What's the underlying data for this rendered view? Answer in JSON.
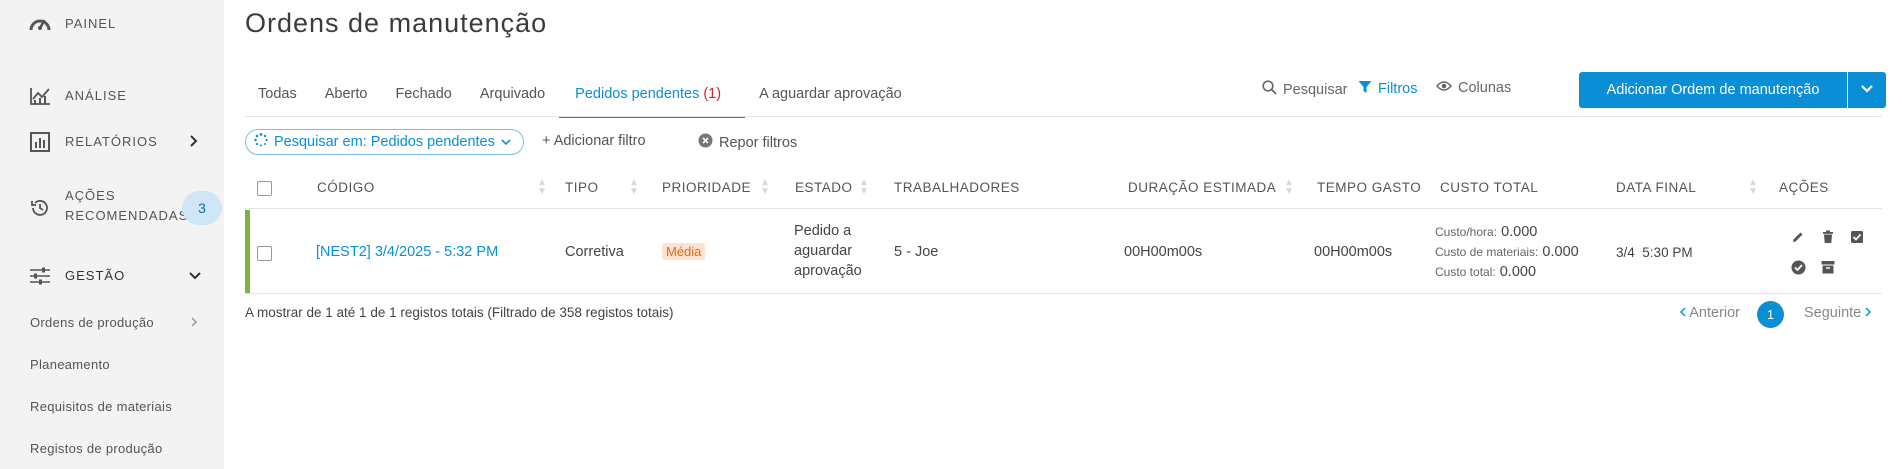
{
  "sidebar": {
    "items": [
      {
        "label": "PAINEL",
        "icon": "dashboard-gauge-icon"
      },
      {
        "label": "ANÁLISE",
        "icon": "analytics-chart-icon"
      },
      {
        "label": "RELATÓRIOS",
        "icon": "reports-bar-icon"
      },
      {
        "label": "AÇÕES",
        "label2": "RECOMENDADAS",
        "icon": "history-clock-icon",
        "badge": "3"
      },
      {
        "label": "GESTÃO",
        "icon": "sliders-icon"
      }
    ],
    "sub_items": [
      "Ordens de produção",
      "Planeamento",
      "Requisitos de materiais",
      "Registos de produção"
    ]
  },
  "page": {
    "title": "Ordens de manutenção"
  },
  "tabs": [
    {
      "label": "Todas"
    },
    {
      "label": "Aberto"
    },
    {
      "label": "Fechado"
    },
    {
      "label": "Arquivado"
    },
    {
      "label": "Pedidos pendentes",
      "count": "(1)",
      "active": true
    },
    {
      "label": "A aguardar aprovação"
    }
  ],
  "toolbar": {
    "search": "Pesquisar",
    "filters": "Filtros",
    "columns": "Colunas",
    "add": "Adicionar Ordem de manutenção"
  },
  "filters": {
    "chip": "Pesquisar em: Pedidos pendentes",
    "add": "+ Adicionar filtro",
    "reset": "Repor filtros"
  },
  "table": {
    "headers": {
      "code": "CÓDIGO",
      "type": "TIPO",
      "priority": "PRIORIDADE",
      "state": "ESTADO",
      "workers": "TRABALHADORES",
      "duration": "DURAÇÃO ESTIMADA",
      "time_spent": "TEMPO GASTO",
      "total_cost": "CUSTO TOTAL",
      "end_date": "DATA FINAL",
      "actions": "AÇÕES"
    },
    "rows": [
      {
        "code": "[NEST2] 3/4/2025 - 5:32 PM",
        "type": "Corretiva",
        "priority": "Média",
        "state_lines": [
          "Pedido a",
          "aguardar",
          "aprovação"
        ],
        "workers": "5 - Joe",
        "duration": "00H00m00s",
        "time_spent": "00H00m00s",
        "cost_hour_label": "Custo/hora:",
        "cost_hour": "0.000",
        "cost_materials_label": "Custo de materiais:",
        "cost_materials": "0.000",
        "cost_total_label": "Custo total:",
        "cost_total": "0.000",
        "end_date": "3/4",
        "end_time": "5:30 PM"
      }
    ]
  },
  "footer": {
    "info": "A mostrar de 1 até 1 de 1 registos totais (Filtrado de 358 registos totais)",
    "prev": "Anterior",
    "current_page": "1",
    "next": "Seguinte"
  },
  "colors": {
    "accent": "#0a8fd6",
    "status_bar": "#7cb342",
    "priority_bg": "#fde3cf",
    "priority_text": "#e06a15",
    "badge_bg": "#cfe6f7"
  }
}
